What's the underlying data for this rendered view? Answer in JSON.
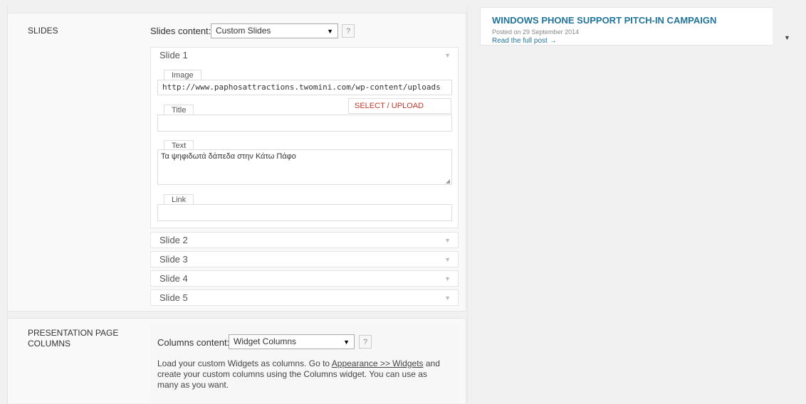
{
  "slides": {
    "section_label": "SLIDES",
    "content_label": "Slides content:",
    "content_value": "Custom Slides",
    "help": "?",
    "slide1": {
      "header": "Slide 1",
      "image_label": "Image",
      "image_value": "http://www.paphosattractions.twomini.com/wp-content/uploads",
      "upload_button": "SELECT / UPLOAD IMAGE",
      "title_label": "Title",
      "title_value": "",
      "text_label": "Text",
      "text_value": "Τα ψηφιδωτά δάπεδα στην Κάτω Πάφο",
      "link_label": "Link",
      "link_value": ""
    },
    "collapsed": [
      "Slide 2",
      "Slide 3",
      "Slide 4",
      "Slide 5"
    ]
  },
  "presentation": {
    "section_label_line1": "PRESENTATION PAGE",
    "section_label_line2": "COLUMNS",
    "content_label": "Columns content:",
    "content_value": "Widget Columns",
    "help": "?",
    "desc_line1_pre": "Load your custom Widgets as columns. Go to ",
    "desc_link": "Appearance >> Widgets",
    "desc_line1_post": " and",
    "desc_line2": "create your custom columns using the Columns widget. You can use as",
    "desc_line3": "many as you want."
  },
  "news": {
    "title": "WINDOWS PHONE SUPPORT PITCH-IN CAMPAIGN",
    "date": "Posted on 29 September 2014",
    "link": "Read the full post →"
  },
  "icons": {
    "dropdown": "chevron-down-icon",
    "collapse": "triangle-down-icon"
  }
}
